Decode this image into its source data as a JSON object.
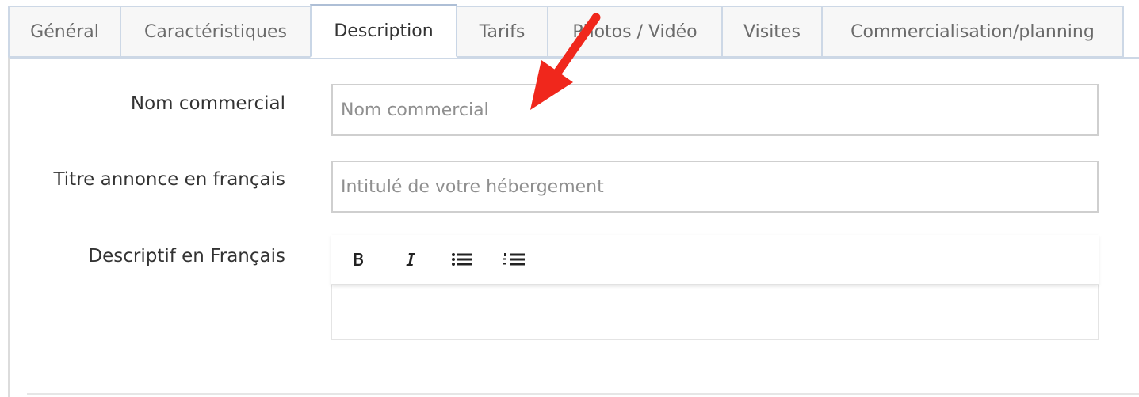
{
  "tabs": [
    {
      "label": "Général",
      "active": false
    },
    {
      "label": "Caractéristiques",
      "active": false
    },
    {
      "label": "Description",
      "active": true
    },
    {
      "label": "Tarifs",
      "active": false
    },
    {
      "label": "Photos / Vidéo",
      "active": false
    },
    {
      "label": "Visites",
      "active": false
    },
    {
      "label": "Commercialisation/planning",
      "active": false
    }
  ],
  "form": {
    "nom_commercial": {
      "label": "Nom commercial",
      "value": "",
      "placeholder": "Nom commercial"
    },
    "titre_annonce": {
      "label": "Titre annonce en français",
      "value": "",
      "placeholder": "Intitulé de votre hébergement"
    },
    "descriptif": {
      "label": "Descriptif en Français",
      "toolbar": [
        "bold-icon",
        "italic-icon",
        "bulleted-list-icon",
        "numbered-list-icon"
      ],
      "value": ""
    }
  },
  "colors": {
    "arrow": "#f0271c",
    "tab_border": "#cdd8e6",
    "input_border": "#cfcfcf",
    "placeholder": "#8f8f8f"
  }
}
